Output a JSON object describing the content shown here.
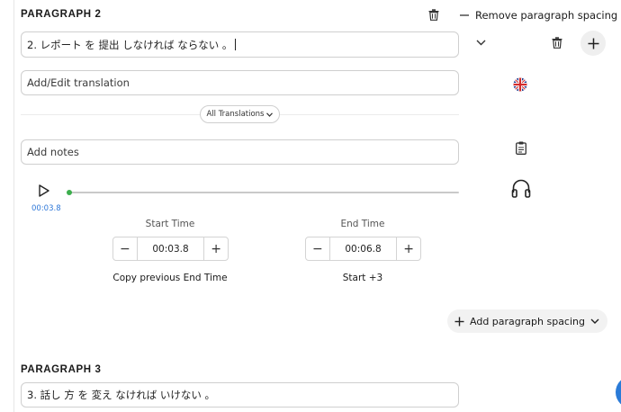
{
  "paragraph2": {
    "heading": "PARAGRAPH 2",
    "remove_spacing_label": "Remove paragraph spacing",
    "text_value": "2. レポート を 提出 しなければ ならない 。",
    "translation_placeholder": "Add/Edit translation",
    "all_translations_label": "All Translations",
    "notes_placeholder": "Add notes",
    "audio": {
      "current_time": "00:03.8",
      "progress": 0.0
    },
    "start_time": {
      "title": "Start Time",
      "value": "00:03.8",
      "minus": "−",
      "plus": "+",
      "action": "Copy previous End Time"
    },
    "end_time": {
      "title": "End Time",
      "value": "00:06.8",
      "minus": "−",
      "plus": "+",
      "action": "Start +3"
    },
    "add_spacing_label": "Add paragraph spacing"
  },
  "paragraph3": {
    "heading": "PARAGRAPH 3",
    "text_value": "3. 話し 方 を 変え なければ いけない 。"
  },
  "icons": [
    "trash-icon",
    "minus-icon",
    "chevron-down-icon",
    "plus-icon",
    "uk-flag-icon",
    "clipboard-icon",
    "headphones-icon",
    "play-icon"
  ],
  "colors": {
    "accent_blue": "#2f78d8",
    "progress_dot": "#3cae4d",
    "fab": "#2a7bd8"
  }
}
